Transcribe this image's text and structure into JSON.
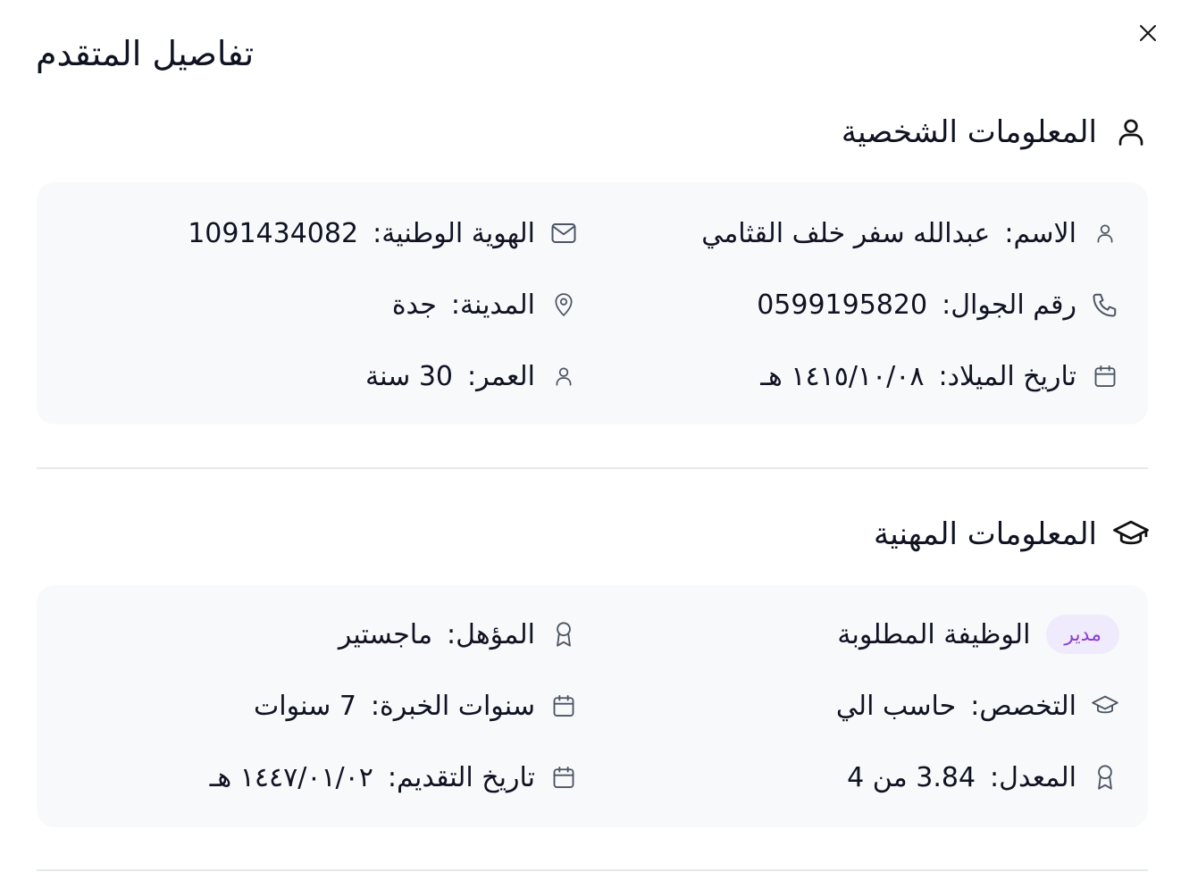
{
  "dialog": {
    "title": "تفاصيل المتقدم",
    "close_icon": "close-icon"
  },
  "personal": {
    "title": "المعلومات الشخصية",
    "icon": "user-icon",
    "fields": {
      "name": {
        "label": "الاسم",
        "value": "عبدالله سفر خلف القثامي",
        "icon": "user-icon"
      },
      "national": {
        "label": "الهوية الوطنية",
        "value": "1091434082",
        "icon": "mail-icon"
      },
      "phone": {
        "label": "رقم الجوال",
        "value": "0599195820",
        "icon": "phone-icon"
      },
      "city": {
        "label": "المدينة",
        "value": "جدة",
        "icon": "map-pin-icon"
      },
      "birth": {
        "label": "تاريخ الميلاد",
        "value": "١٤١٥/١٠/٠٨ هـ",
        "icon": "calendar-icon"
      },
      "age": {
        "label": "العمر",
        "value": "30 سنة",
        "icon": "user-icon"
      }
    }
  },
  "professional": {
    "title": "المعلومات المهنية",
    "icon": "graduation-cap-icon",
    "fields": {
      "job": {
        "label": "الوظيفة المطلوبة",
        "badge": "مدير"
      },
      "degree": {
        "label": "المؤهل",
        "value": "ماجستير",
        "icon": "award-icon"
      },
      "major": {
        "label": "التخصص",
        "value": "حاسب الي",
        "icon": "graduation-cap-icon"
      },
      "experience": {
        "label": "سنوات الخبرة",
        "value": "7 سنوات",
        "icon": "calendar-icon"
      },
      "gpa": {
        "label": "المعدل",
        "value": "3.84 من 4",
        "icon": "award-icon"
      },
      "applied": {
        "label": "تاريخ التقديم",
        "value": "١٤٤٧/٠١/٠٢ هـ",
        "icon": "calendar-icon"
      }
    }
  },
  "colors": {
    "badge_bg": "#f0eafd",
    "badge_text": "#8b3fd6",
    "card_bg": "#f8f9fb",
    "text": "#0f1322",
    "icon": "#4b5563"
  }
}
